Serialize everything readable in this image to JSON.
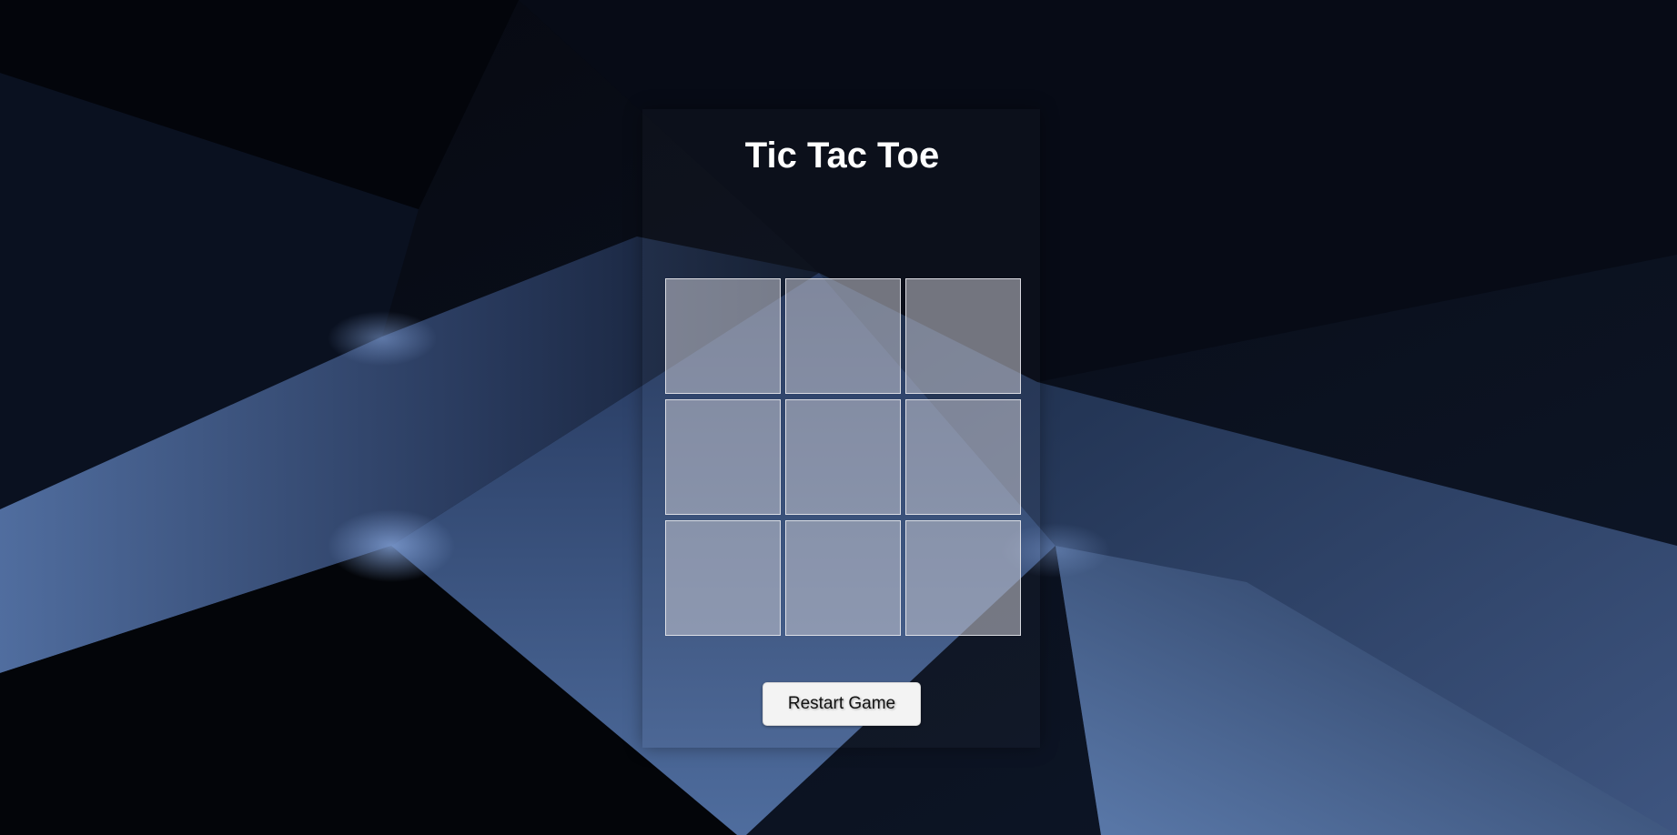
{
  "game": {
    "title": "Tic Tac Toe",
    "board": [
      [
        "",
        "",
        ""
      ],
      [
        "",
        "",
        ""
      ],
      [
        "",
        "",
        ""
      ]
    ],
    "restart_label": "Restart Game"
  },
  "colors": {
    "background_dark": "#04060f",
    "background_blue": "#4a6796",
    "cell_fill": "#b4b6c2",
    "title_text": "#ffffff",
    "button_fill": "#f3f3f3"
  }
}
